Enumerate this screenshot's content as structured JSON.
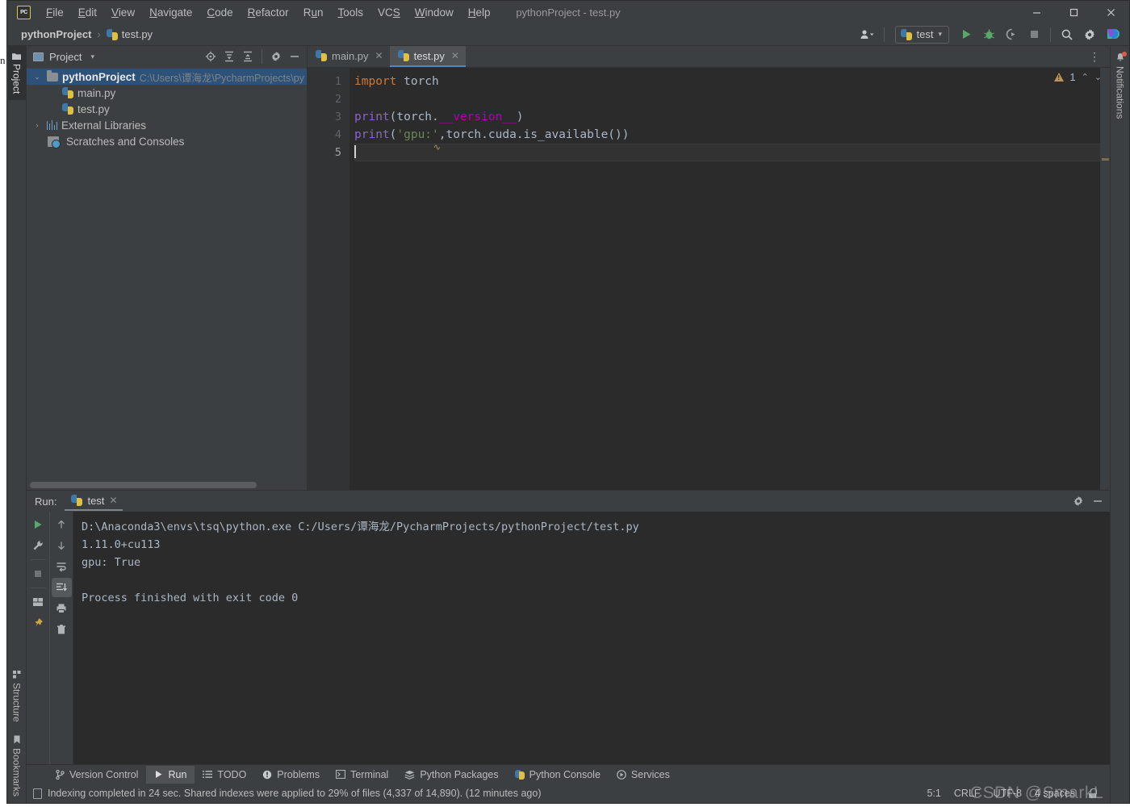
{
  "window": {
    "title": "pythonProject - test.py",
    "app_logo_text": "PC",
    "controls": {
      "minimize": "—",
      "maximize": "▢",
      "close": "✕"
    }
  },
  "menu": {
    "items": [
      "File",
      "Edit",
      "View",
      "Navigate",
      "Code",
      "Refactor",
      "Run",
      "Tools",
      "VCS",
      "Window",
      "Help"
    ]
  },
  "breadcrumb": {
    "project": "pythonProject",
    "separator": "›",
    "file": "test.py"
  },
  "toolbar": {
    "account_icon": "user-icon",
    "run_config_name": "test",
    "run_config_caret": "▾",
    "run_button": "run-icon",
    "debug_button": "debug-icon",
    "coverage_button": "coverage-icon",
    "stop_button": "stop-icon",
    "search_button": "search-icon",
    "settings_button": "settings-icon",
    "updates_button": "updates-icon"
  },
  "left_strip": {
    "tabs": [
      {
        "label": "Project",
        "icon": "folder-icon",
        "active": true
      },
      {
        "label": "Structure",
        "icon": "structure-icon",
        "active": false
      },
      {
        "label": "Bookmarks",
        "icon": "bookmark-icon",
        "active": false
      }
    ]
  },
  "right_strip": {
    "tabs": [
      {
        "label": "Notifications",
        "icon": "bell-icon",
        "badge": true
      }
    ]
  },
  "project_pane": {
    "title": "Project",
    "caret": "▾",
    "tools": [
      "locate-icon",
      "expand-all-icon",
      "collapse-all-icon",
      "settings-icon",
      "hide-icon"
    ],
    "tree": [
      {
        "label": "pythonProject",
        "path": "C:\\Users\\谭海龙\\PycharmProjects\\py",
        "icon": "folder-icon",
        "arrow": "⌄",
        "indent": 0,
        "bold": true,
        "selected": true
      },
      {
        "label": "main.py",
        "path": "",
        "icon": "python-file-icon",
        "arrow": "",
        "indent": 1,
        "bold": false,
        "selected": false
      },
      {
        "label": "test.py",
        "path": "",
        "icon": "python-file-icon",
        "arrow": "",
        "indent": 1,
        "bold": false,
        "selected": false
      },
      {
        "label": "External Libraries",
        "path": "",
        "icon": "library-icon",
        "arrow": "›",
        "indent": 0,
        "bold": false,
        "selected": false
      },
      {
        "label": "Scratches and Consoles",
        "path": "",
        "icon": "scratch-icon",
        "arrow": "",
        "indent": 0,
        "bold": false,
        "selected": false
      }
    ]
  },
  "editor": {
    "tabs": [
      {
        "label": "main.py",
        "icon": "python-file-icon",
        "active": false,
        "close": "✕"
      },
      {
        "label": "test.py",
        "icon": "python-file-icon",
        "active": true,
        "close": "✕"
      }
    ],
    "kebab": "⋮",
    "line_numbers": [
      "1",
      "2",
      "3",
      "4",
      "5"
    ],
    "current_line": 5,
    "inspection": {
      "warning_count": "1",
      "warning_icon": "warning-triangle-icon",
      "up_icon": "⌃",
      "down_icon": "⌄"
    },
    "lines": [
      {
        "n": 1,
        "tokens": [
          {
            "t": "import",
            "c": "kw"
          },
          {
            "t": " torch",
            "c": "id"
          }
        ]
      },
      {
        "n": 2,
        "tokens": []
      },
      {
        "n": 3,
        "tokens": []
      },
      {
        "n": 4,
        "tokens": [
          {
            "t": "print",
            "c": "fn"
          },
          {
            "t": "(torch.",
            "c": "punct"
          },
          {
            "t": "__version__",
            "c": "dunder"
          },
          {
            "t": ")",
            "c": "punct"
          }
        ]
      },
      {
        "n": 5,
        "tokens": [
          {
            "t": "print",
            "c": "fn"
          },
          {
            "t": "(",
            "c": "punct"
          },
          {
            "t": "'gpu:'",
            "c": "str"
          },
          {
            "t": ",torch.cuda.is_available())",
            "c": "punct"
          }
        ]
      }
    ],
    "code_text": {
      "l1_kw": "import",
      "l1_mod": " torch",
      "l3_fn": "print",
      "l3_a": "(torch.",
      "l3_dunder": "__version__",
      "l3_b": ")",
      "l4_fn": "print",
      "l4_a": "(",
      "l4_str": "'gpu:'",
      "l4_b": ",torch.cuda.is_available())"
    }
  },
  "run_pane": {
    "label": "Run:",
    "tab_name": "test",
    "tab_close": "✕",
    "header_tools": [
      "settings-icon",
      "hide-icon"
    ],
    "tools_left": [
      "rerun-icon",
      "wrench-icon",
      "stop-icon",
      "layout-icon",
      "pin-icon"
    ],
    "tools_right": [
      "up-icon",
      "down-icon",
      "soft-wrap-icon",
      "scroll-to-end-icon",
      "print-icon",
      "trash-icon"
    ],
    "console_lines": [
      "D:\\Anaconda3\\envs\\tsq\\python.exe C:/Users/谭海龙/PycharmProjects/pythonProject/test.py",
      "1.11.0+cu113",
      "gpu: True",
      "",
      "Process finished with exit code 0"
    ]
  },
  "bottom_bar": {
    "tabs": [
      {
        "label": "Version Control",
        "icon": "branch-icon",
        "active": false
      },
      {
        "label": "Run",
        "icon": "run-icon",
        "active": true
      },
      {
        "label": "TODO",
        "icon": "todo-icon",
        "active": false
      },
      {
        "label": "Problems",
        "icon": "problems-icon",
        "active": false
      },
      {
        "label": "Terminal",
        "icon": "terminal-icon",
        "active": false
      },
      {
        "label": "Python Packages",
        "icon": "packages-icon",
        "active": false
      },
      {
        "label": "Python Console",
        "icon": "python-console-icon",
        "active": false
      },
      {
        "label": "Services",
        "icon": "services-icon",
        "active": false
      }
    ]
  },
  "status_bar": {
    "message": "Indexing completed in 24 sec. Shared indexes were applied to 29% of files (4,337 of 14,890). (12 minutes ago)",
    "message_icon": "indexing-icon",
    "caret_position": "5:1",
    "line_separator": "CRLF",
    "encoding": "UTF-8",
    "indent": "4 spaces",
    "lock_icon": "lock-icon",
    "watermark": "CSDN @SmarkL"
  },
  "colors": {
    "bg_panel": "#3c3f41",
    "bg_editor": "#2b2b2b",
    "accent_blue": "#4a88c7",
    "selection_blue": "#2d5177",
    "keyword_orange": "#cc7832",
    "function_purple": "#8a63d2",
    "string_green": "#6a8759",
    "dunder_magenta": "#b200b2",
    "identifier_gray": "#a9b7c6",
    "warning_gold": "#bc9458",
    "run_green": "#59a869"
  }
}
